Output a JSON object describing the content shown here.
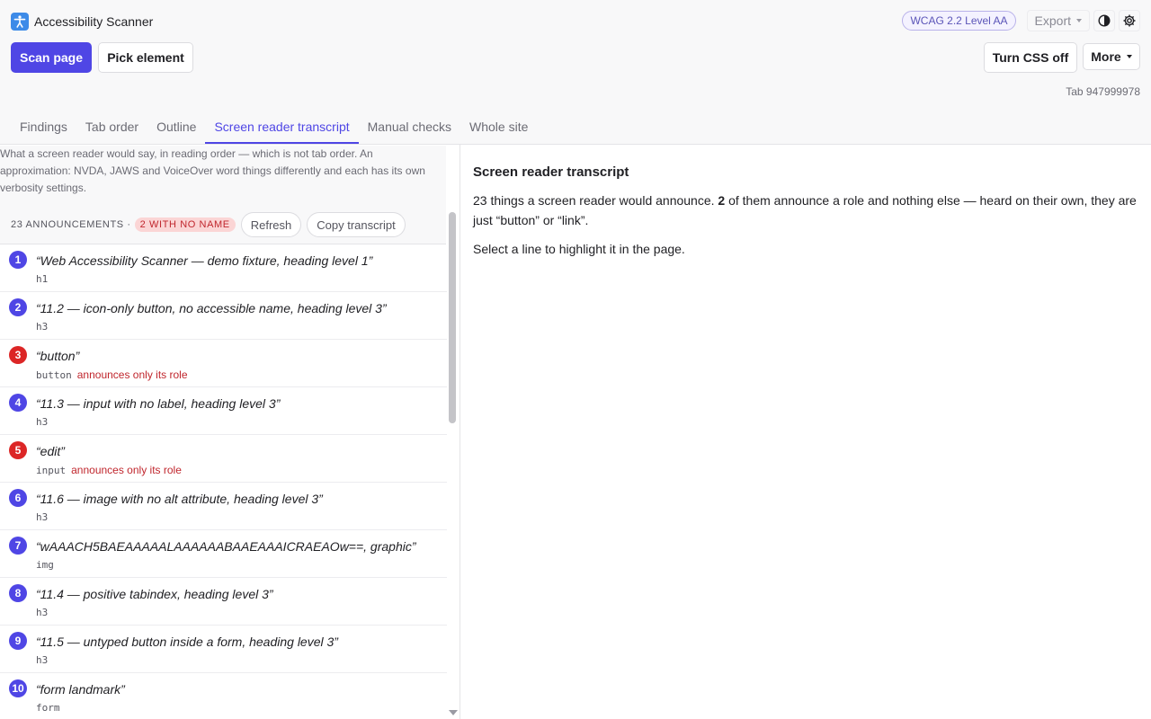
{
  "app": {
    "title": "Accessibility Scanner",
    "logo_icon": "accessibility-person-icon"
  },
  "top_right": {
    "standard": "WCAG 2.2 Level AA",
    "export_label": "Export",
    "contrast_icon": "contrast-icon",
    "settings_icon": "gear-icon"
  },
  "actions": {
    "scan_page": "Scan page",
    "pick_element": "Pick element",
    "turn_css_off": "Turn CSS off",
    "more": "More"
  },
  "tab_id": "Tab 947999978",
  "tabs": [
    {
      "label": "Findings",
      "active": false
    },
    {
      "label": "Tab order",
      "active": false
    },
    {
      "label": "Outline",
      "active": false
    },
    {
      "label": "Screen reader transcript",
      "active": true
    },
    {
      "label": "Manual checks",
      "active": false
    },
    {
      "label": "Whole site",
      "active": false
    }
  ],
  "transcript": {
    "description": "What a screen reader would say, in reading order — which is not tab order. An approximation: NVDA, JAWS and VoiceOver word things differently and each has its own verbosity settings.",
    "count_label": "23 ANNOUNCEMENTS ·",
    "noname_badge": "2 WITH NO NAME",
    "refresh_label": "Refresh",
    "copy_label": "Copy transcript",
    "items": [
      {
        "num": "1",
        "text": "“Web Accessibility Scanner — demo fixture, heading level 1”",
        "tag": "h1",
        "issue": ""
      },
      {
        "num": "2",
        "text": "“11.2 — icon-only button, no accessible name, heading level 3”",
        "tag": "h3",
        "issue": ""
      },
      {
        "num": "3",
        "text": "“button”",
        "tag": "button",
        "issue": "announces only its role"
      },
      {
        "num": "4",
        "text": "“11.3 — input with no label, heading level 3”",
        "tag": "h3",
        "issue": ""
      },
      {
        "num": "5",
        "text": "“edit”",
        "tag": "input",
        "issue": "announces only its role"
      },
      {
        "num": "6",
        "text": "“11.6 — image with no alt attribute, heading level 3”",
        "tag": "h3",
        "issue": ""
      },
      {
        "num": "7",
        "text": "“wAAACH5BAEAAAAALAAAAAABAAEAAAICRAEAOw==, graphic”",
        "tag": "img",
        "issue": ""
      },
      {
        "num": "8",
        "text": "“11.4 — positive tabindex, heading level 3”",
        "tag": "h3",
        "issue": ""
      },
      {
        "num": "9",
        "text": "“11.5 — untyped button inside a form, heading level 3”",
        "tag": "h3",
        "issue": ""
      },
      {
        "num": "10",
        "text": "“form landmark”",
        "tag": "form",
        "issue": ""
      }
    ]
  },
  "detail": {
    "title": "Screen reader transcript",
    "summary_pre": "23 things a screen reader would announce.",
    "summary_count": "2",
    "summary_post": "of them announce a role and nothing else — heard on their own, they are just “button” or “link”.",
    "hint": "Select a line to highlight it in the page."
  },
  "colors": {
    "accent": "#4f46e5",
    "danger": "#dc2626",
    "logo": "#3d8be8"
  }
}
